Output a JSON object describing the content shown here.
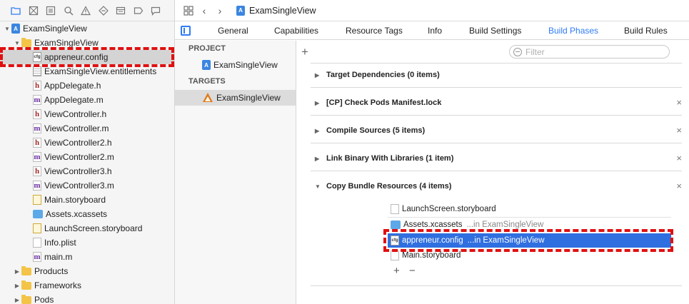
{
  "navigator": {
    "tree": [
      {
        "label": "ExamSingleView",
        "icon": "project-icon",
        "disclosure": "open"
      },
      {
        "label": "ExamSingleView",
        "icon": "folder-icon",
        "disclosure": "open"
      },
      {
        "label": "appreneur.config",
        "icon": "config-file-icon",
        "selected": true
      },
      {
        "label": "ExamSingleView.entitlements",
        "icon": "entitlements-file-icon"
      },
      {
        "label": "AppDelegate.h",
        "icon": "header-file-icon"
      },
      {
        "label": "AppDelegate.m",
        "icon": "objc-file-icon"
      },
      {
        "label": "ViewController.h",
        "icon": "header-file-icon"
      },
      {
        "label": "ViewController.m",
        "icon": "objc-file-icon"
      },
      {
        "label": "ViewController2.h",
        "icon": "header-file-icon"
      },
      {
        "label": "ViewController2.m",
        "icon": "objc-file-icon"
      },
      {
        "label": "ViewController3.h",
        "icon": "header-file-icon"
      },
      {
        "label": "ViewController3.m",
        "icon": "objc-file-icon"
      },
      {
        "label": "Main.storyboard",
        "icon": "storyboard-file-icon"
      },
      {
        "label": "Assets.xcassets",
        "icon": "asset-catalog-icon"
      },
      {
        "label": "LaunchScreen.storyboard",
        "icon": "storyboard-file-icon"
      },
      {
        "label": "Info.plist",
        "icon": "plist-file-icon"
      },
      {
        "label": "main.m",
        "icon": "objc-file-icon"
      },
      {
        "label": "Products",
        "icon": "folder-icon",
        "disclosure": "closed"
      },
      {
        "label": "Frameworks",
        "icon": "folder-icon",
        "disclosure": "closed"
      },
      {
        "label": "Pods",
        "icon": "folder-icon",
        "disclosure": "closed"
      }
    ],
    "icon_glyphs": {
      "h": "h",
      "m": "m",
      "cfg": "cfg"
    }
  },
  "jump_bar": {
    "title": "ExamSingleView"
  },
  "tabs": [
    {
      "label": "General"
    },
    {
      "label": "Capabilities"
    },
    {
      "label": "Resource Tags"
    },
    {
      "label": "Info"
    },
    {
      "label": "Build Settings"
    },
    {
      "label": "Build Phases",
      "active": true
    },
    {
      "label": "Build Rules"
    }
  ],
  "targets_panel": {
    "project_header": "PROJECT",
    "project_item": "ExamSingleView",
    "targets_header": "TARGETS",
    "target_item": "ExamSingleView"
  },
  "phases": {
    "add_symbol": "+",
    "filter_placeholder": "Filter",
    "items": [
      {
        "title": "Target Dependencies (0 items)",
        "deletable": false
      },
      {
        "title": "[CP] Check Pods Manifest.lock",
        "deletable": true
      },
      {
        "title": "Compile Sources (5 items)",
        "deletable": true
      },
      {
        "title": "Link Binary With Libraries (1 item)",
        "deletable": true
      },
      {
        "title": "Copy Bundle Resources (4 items)",
        "deletable": true,
        "expanded": true
      }
    ],
    "delete_symbol": "×",
    "resources": [
      {
        "name": "LaunchScreen.storyboard",
        "location": ""
      },
      {
        "name": "Assets.xcassets",
        "location": "...in ExamSingleView"
      },
      {
        "name": "appreneur.config",
        "location": "...in ExamSingleView",
        "selected": true
      },
      {
        "name": "Main.storyboard",
        "location": ""
      }
    ],
    "resource_add": "+",
    "resource_remove": "−"
  }
}
